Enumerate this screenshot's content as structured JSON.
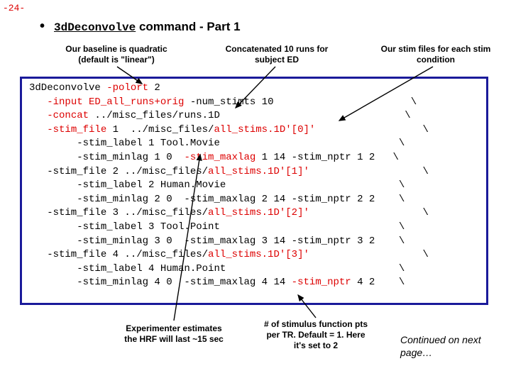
{
  "page_number": "-24-",
  "title_cmd": "3dDeconvolve",
  "title_rest": " command - Part 1",
  "annotations": {
    "baseline": "Our baseline is quadratic (default is \"linear\")",
    "concat": "Concatenated 10 runs for subject ED",
    "stimfiles": "Our stim files for each stim condition",
    "experimenter": "Experimenter estimates the HRF will last ~15 sec",
    "nptr": "# of stimulus function pts per TR.  Default = 1. Here it's set to 2",
    "continued": "Continued on next page…"
  },
  "code": {
    "l1a": "3dDeconvolve ",
    "l1b": "-polort",
    "l1c": " 2",
    "l2a": "   ",
    "l2b": "-input ED_all_runs+orig",
    "l2c": " -num_stimts 10                       \\",
    "l3a": "   ",
    "l3b": "-concat",
    "l3c": " ../misc_files/runs.1D                               \\",
    "l4a": "   ",
    "l4b": "-stim_file",
    "l4c": " 1  ../misc_files/",
    "l4d": "all_stims.1D'[0]'",
    "l4e": "                  \\",
    "l5": "        -stim_label 1 Tool.Movie                              \\",
    "l6a": "        -stim_minlag 1 0  ",
    "l6b": "-stim_maxlag",
    "l6c": " 1 14 -stim_nptr 1 2   \\",
    "l7a": "   -stim_file 2 ../misc_files/",
    "l7b": "all_stims.1D'[1]'",
    "l7c": "                   \\",
    "l8": "        -stim_label 2 Human.Movie                             \\",
    "l9": "        -stim_minlag 2 0  -stim_maxlag 2 14 -stim_nptr 2 2    \\",
    "l10a": "   -stim_file 3 ../misc_files/",
    "l10b": "all_stims.1D'[2]'",
    "l10c": "                   \\",
    "l11": "        -stim_label 3 Tool.Point                              \\",
    "l12": "        -stim_minlag 3 0  -stim_maxlag 3 14 -stim_nptr 3 2    \\",
    "l13a": "   -stim_file 4 ../misc_files/",
    "l13b": "all_stims.1D'[3]'",
    "l13c": "                   \\",
    "l14": "        -stim_label 4 Human.Point                             \\",
    "l15a": "        -stim_minlag 4 0  -stim_maxlag 4 14 ",
    "l15b": "-stim_nptr",
    "l15c": " 4 2    \\"
  }
}
